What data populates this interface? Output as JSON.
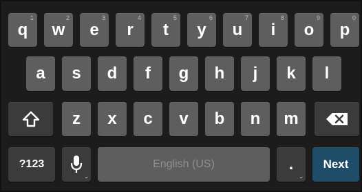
{
  "rows": {
    "row1": [
      {
        "label": "q",
        "hint": "1"
      },
      {
        "label": "w",
        "hint": "2"
      },
      {
        "label": "e",
        "hint": "3"
      },
      {
        "label": "r",
        "hint": "4"
      },
      {
        "label": "t",
        "hint": "5"
      },
      {
        "label": "y",
        "hint": "6"
      },
      {
        "label": "u",
        "hint": "7"
      },
      {
        "label": "i",
        "hint": "8"
      },
      {
        "label": "o",
        "hint": "9"
      },
      {
        "label": "p",
        "hint": "0"
      }
    ],
    "row2": [
      "a",
      "s",
      "d",
      "f",
      "g",
      "h",
      "j",
      "k",
      "l"
    ],
    "row3": [
      "z",
      "x",
      "c",
      "v",
      "b",
      "n",
      "m"
    ]
  },
  "bottom": {
    "symbols_label": "?123",
    "space_label": "English (US)",
    "period_label": ".",
    "next_label": "Next",
    "mic_dots": "...",
    "period_dots": "..."
  },
  "icons": {
    "shift": "shift-icon",
    "delete": "backspace-icon",
    "mic": "microphone-icon"
  },
  "colors": {
    "keyboard_bg": "#1c1c1c",
    "key": "#5e5e5e",
    "special_key": "#3b3b3b",
    "next_key": "#1f4d68"
  }
}
